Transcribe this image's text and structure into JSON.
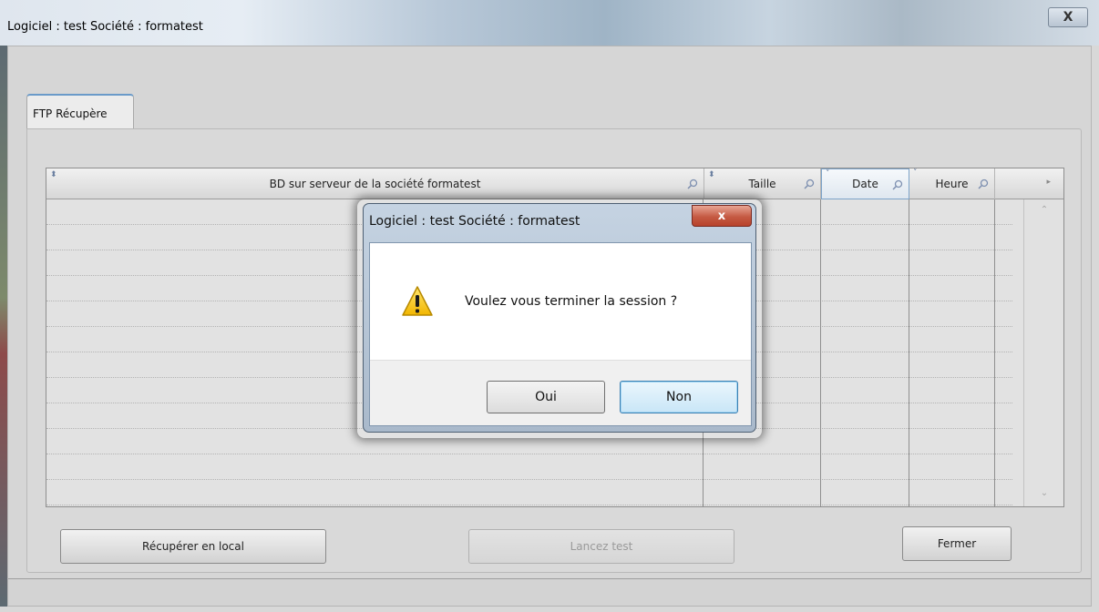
{
  "window": {
    "title": "Logiciel : test Société : formatest",
    "close_label": "X"
  },
  "tabs": [
    {
      "label": "FTP Récupère"
    }
  ],
  "table": {
    "columns": [
      {
        "label": "BD sur serveur de la société formatest"
      },
      {
        "label": "Taille"
      },
      {
        "label": "Date"
      },
      {
        "label": "Heure"
      }
    ],
    "row_count": 12
  },
  "buttons": {
    "recover": "Récupérer en local",
    "test": "Lancez test",
    "close": "Fermer"
  },
  "dialog": {
    "title": "Logiciel : test Société : formatest",
    "close_label": "x",
    "message": "Voulez vous terminer la session ?",
    "yes": "Oui",
    "no": "Non",
    "icon": "warning-icon"
  }
}
